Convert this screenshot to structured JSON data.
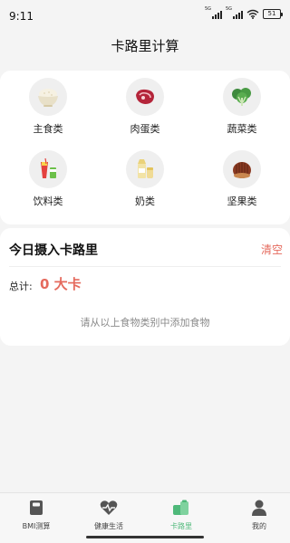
{
  "status_bar": {
    "time": "9:11",
    "signal1_tag": "5G",
    "signal2_tag": "5G",
    "battery": "51"
  },
  "header": {
    "title": "卡路里计算"
  },
  "categories": [
    {
      "label": "主食类",
      "icon": "rice-bowl-icon"
    },
    {
      "label": "肉蛋类",
      "icon": "meat-icon"
    },
    {
      "label": "蔬菜类",
      "icon": "vegetable-icon"
    },
    {
      "label": "饮料类",
      "icon": "drink-icon"
    },
    {
      "label": "奶类",
      "icon": "milk-icon"
    },
    {
      "label": "坚果类",
      "icon": "nut-icon"
    }
  ],
  "today": {
    "title": "今日摄入卡路里",
    "clear_label": "清空",
    "total_label": "总计:",
    "total_value": "0 大卡",
    "empty_hint": "请从以上食物类别中添加食物"
  },
  "tabbar": {
    "active_index": 2,
    "active_color": "#4fb97a",
    "items": [
      {
        "label": "BMI测算",
        "icon": "scale-icon"
      },
      {
        "label": "健康生活",
        "icon": "heart-icon"
      },
      {
        "label": "卡路里",
        "icon": "calorie-icon"
      },
      {
        "label": "我的",
        "icon": "person-icon"
      }
    ]
  },
  "colors": {
    "accent_red": "#e56a5d",
    "accent_green": "#4fb97a"
  }
}
